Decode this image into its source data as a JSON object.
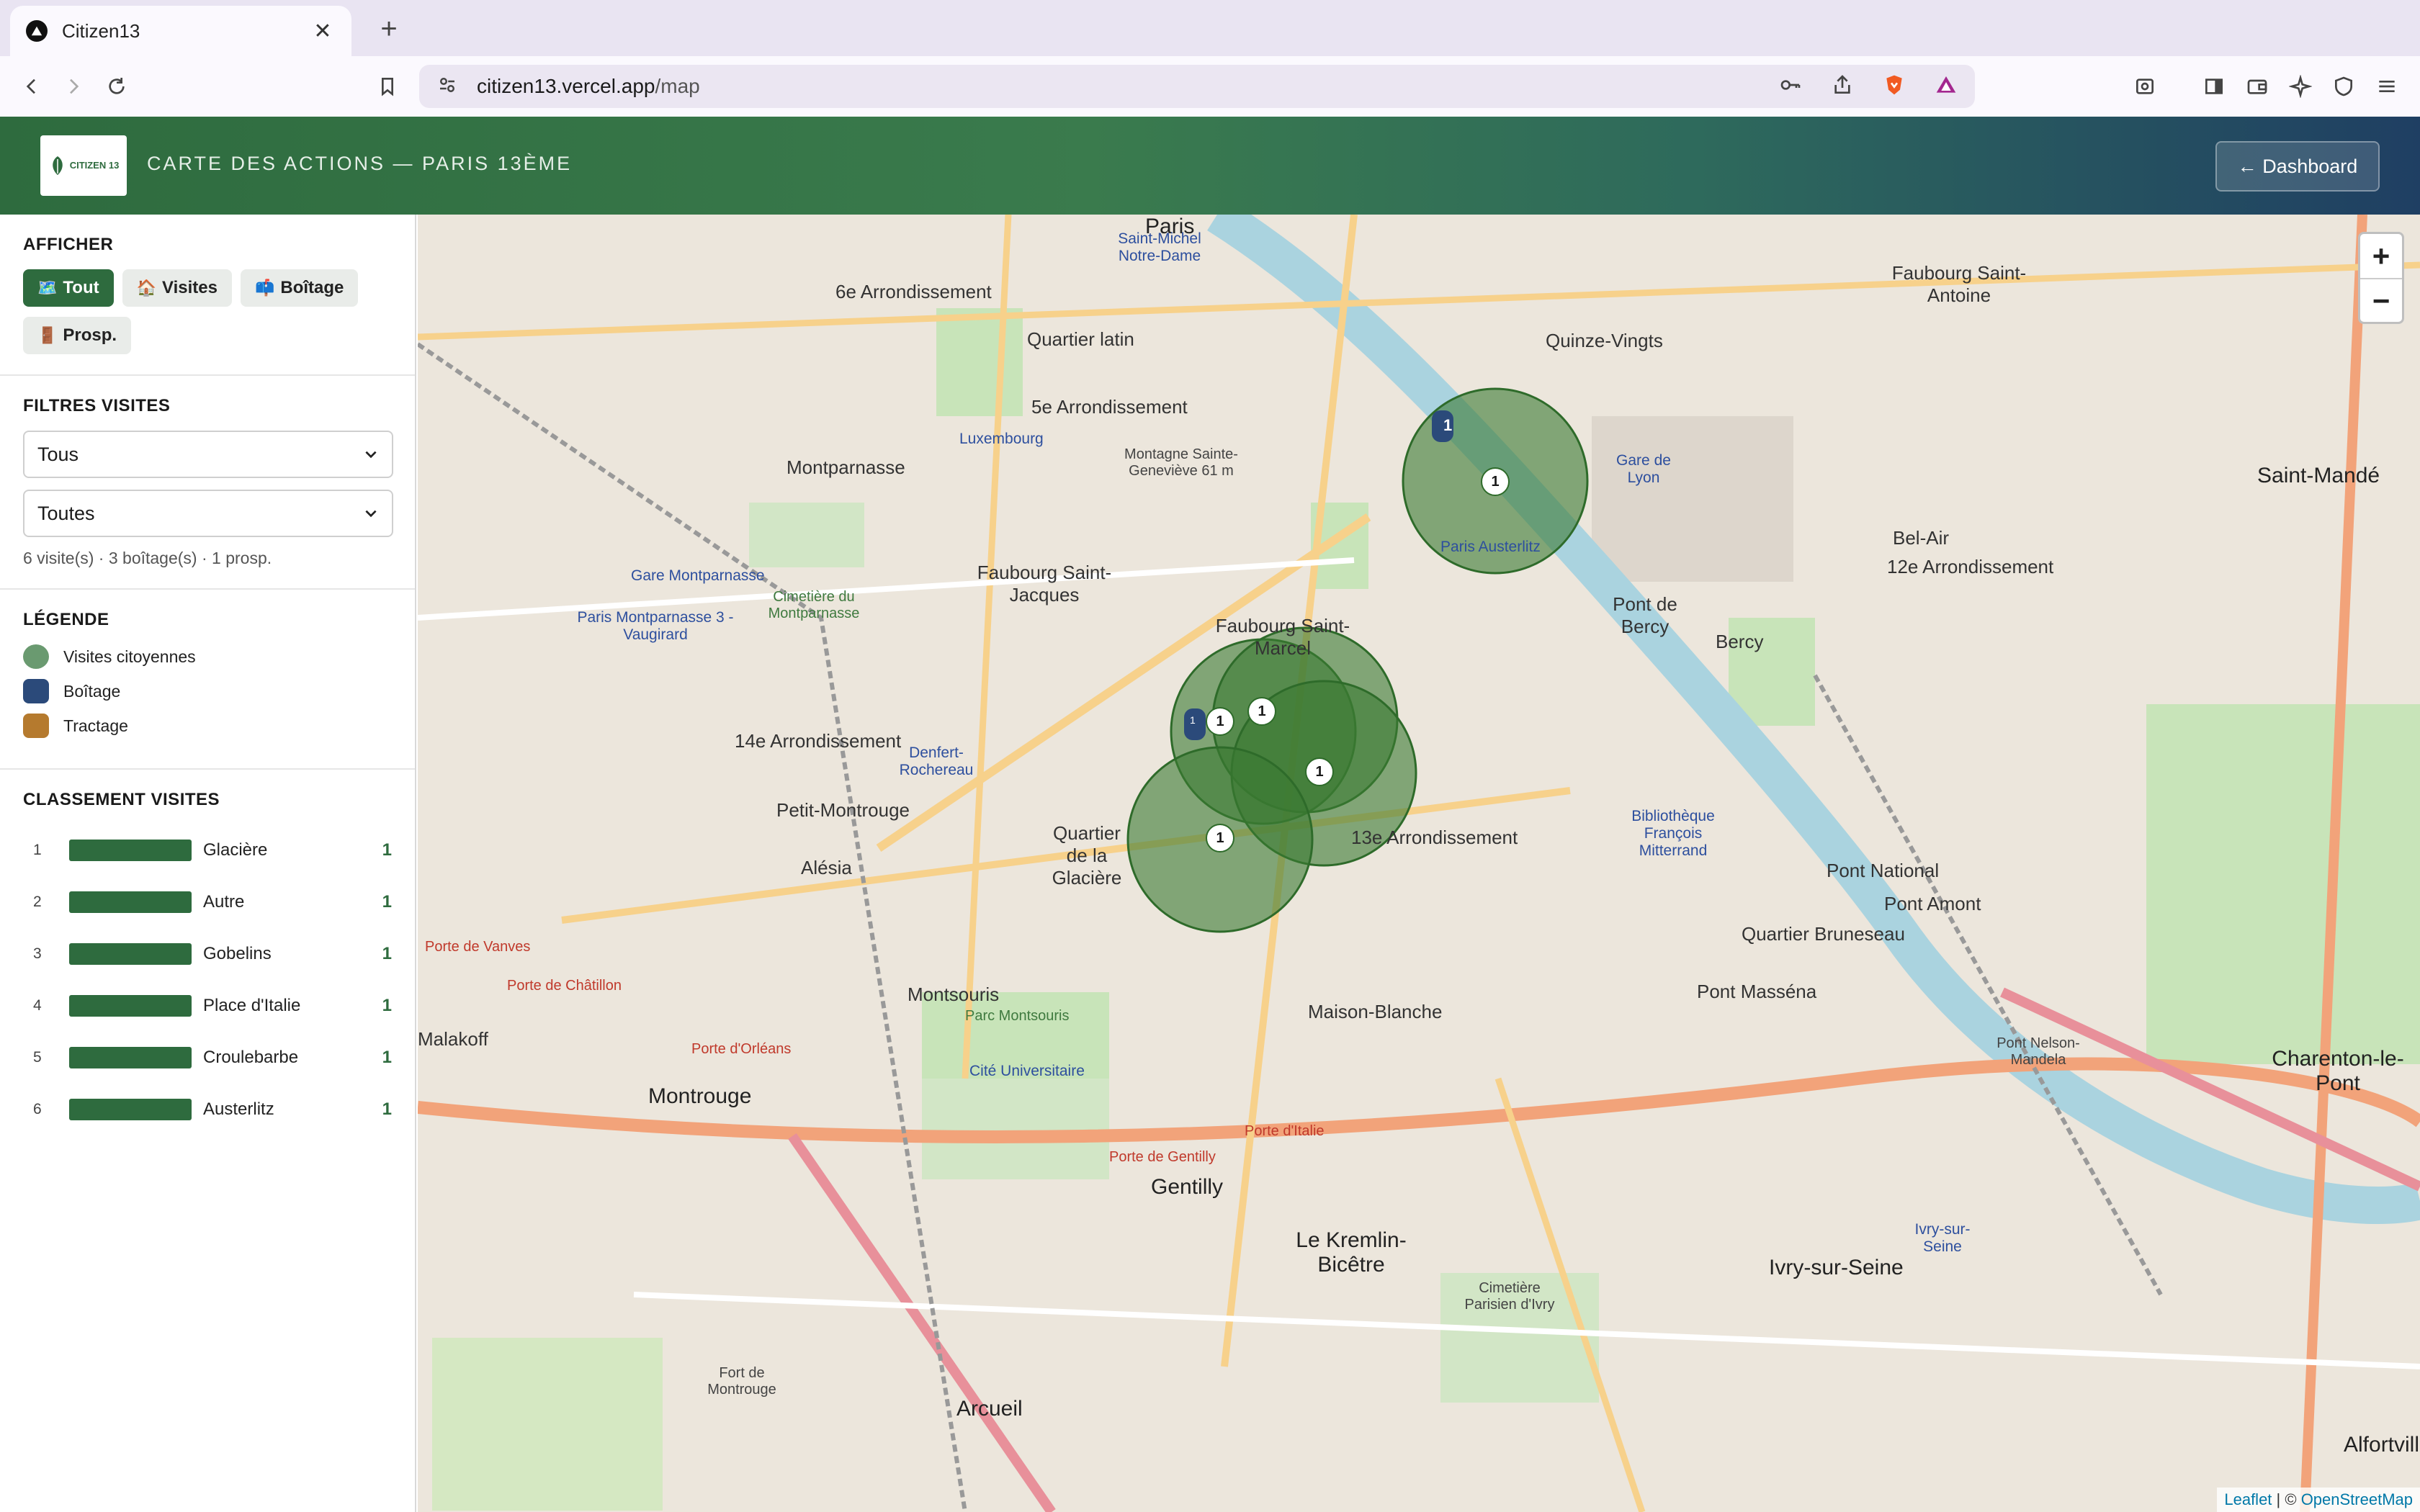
{
  "browser": {
    "tab_title": "Citizen13",
    "url_host": "citizen13.vercel.app",
    "url_path": "/map"
  },
  "header": {
    "logo_text": "CITIZEN 13",
    "title": "CARTE DES ACTIONS — PARIS 13ÈME",
    "dashboard_label": "← Dashboard"
  },
  "sidebar": {
    "display": {
      "title": "AFFICHER",
      "chips": [
        {
          "icon": "🗺️",
          "label": "Tout",
          "active": true
        },
        {
          "icon": "🏠",
          "label": "Visites",
          "active": false
        },
        {
          "icon": "📫",
          "label": "Boîtage",
          "active": false
        },
        {
          "icon": "🚪",
          "label": "Prosp.",
          "active": false
        }
      ]
    },
    "filters": {
      "title": "FILTRES VISITES",
      "select1": "Tous",
      "select2": "Toutes",
      "counts": "6 visite(s) · 3 boîtage(s) · 1 prosp."
    },
    "legend": {
      "title": "LÉGENDE",
      "items": [
        {
          "label": "Visites citoyennes",
          "color": "#6a9a70"
        },
        {
          "label": "Boîtage",
          "color": "#2b4a7a"
        },
        {
          "label": "Tractage",
          "color": "#b57a2e"
        }
      ]
    },
    "ranking": {
      "title": "CLASSEMENT VISITES",
      "rows": [
        {
          "rank": "1",
          "name": "Glacière",
          "count": "1"
        },
        {
          "rank": "2",
          "name": "Autre",
          "count": "1"
        },
        {
          "rank": "3",
          "name": "Gobelins",
          "count": "1"
        },
        {
          "rank": "4",
          "name": "Place d'Italie",
          "count": "1"
        },
        {
          "rank": "5",
          "name": "Croulebarbe",
          "count": "1"
        },
        {
          "rank": "6",
          "name": "Austerlitz",
          "count": "1"
        }
      ]
    }
  },
  "map": {
    "zoom_in": "+",
    "zoom_out": "−",
    "attribution_leaflet": "Leaflet",
    "attribution_sep": " | © ",
    "attribution_osm": "OpenStreetMap",
    "markers": [
      "1",
      "1",
      "1",
      "1",
      "1",
      "1",
      "1"
    ],
    "places": [
      "6e Arrondissement",
      "Quartier latin",
      "5e Arrondissement",
      "Luxembourg",
      "Montparnasse",
      "Faubourg Saint-Jacques",
      "Gare Montparnasse",
      "Paris Montparnasse 3 - Vaugirard",
      "Cimetière du Montparnasse",
      "14e Arrondissement",
      "Denfert-Rochereau",
      "Petit-Montrouge",
      "Alésia",
      "Quartier de la Glacière",
      "13e Arrondissement",
      "Montsouris",
      "Parc Montsouris",
      "Cité Universitaire",
      "Maison-Blanche",
      "Montrouge",
      "Gentilly",
      "Le Kremlin-Bicêtre",
      "Arcueil",
      "Ivry-sur-Seine",
      "Charenton-le-Pont",
      "Saint-Mandé",
      "12e Arrondissement",
      "Bel-Air",
      "Bercy",
      "Pont National",
      "Pont Amont",
      "Quartier Bruneseau",
      "Pont Masséna",
      "Bibliothèque François Mitterrand",
      "Faubourg Saint-Antoine",
      "Quinze-Vingts",
      "Pont de Bercy",
      "Gare de Lyon",
      "Paris Austerlitz",
      "Montagne Sainte-Geneviève 61 m",
      "Saint-Michel Notre-Dame",
      "Paris",
      "Faubourg Saint-Marcel",
      "Cimetière Parisien d'Ivry",
      "Fort de Montrouge",
      "Alfortvill",
      "Porte de Vanves",
      "Porte de Châtillon",
      "Porte d'Orléans",
      "Porte de Gentilly",
      "Porte d'Italie",
      "Ivry-sur-Seine",
      "Pont Nelson-Mandela",
      "Malakoff"
    ]
  }
}
